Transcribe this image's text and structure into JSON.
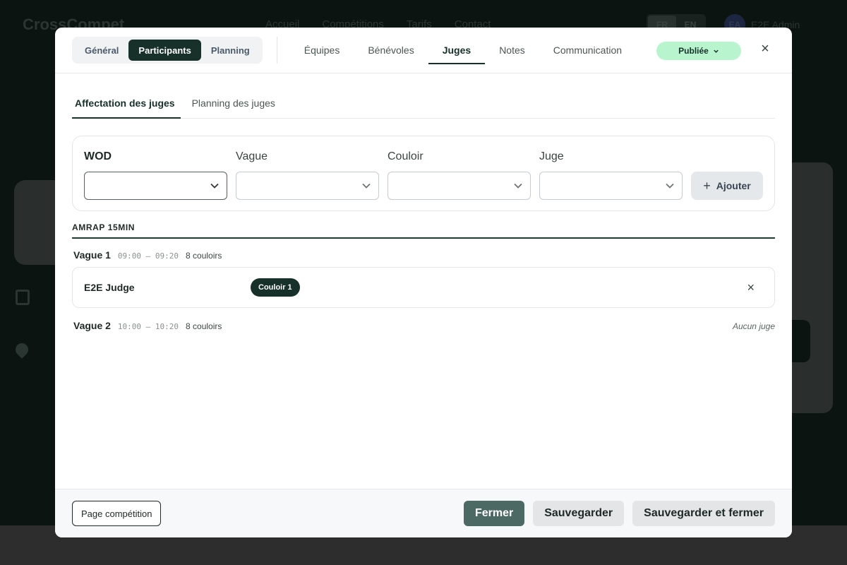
{
  "background": {
    "logo": "CrossCompet",
    "nav": [
      "Accueil",
      "Compétitions",
      "Tarifs",
      "Contact"
    ],
    "lang": [
      "FR",
      "EN"
    ],
    "user_initials": "EA",
    "user_name": "E2E Admin"
  },
  "header": {
    "segments": [
      "Général",
      "Participants",
      "Planning"
    ],
    "active_segment": "Participants",
    "tabs": [
      "Équipes",
      "Bénévoles",
      "Juges",
      "Notes",
      "Communication"
    ],
    "active_tab": "Juges",
    "status_label": "Publiée",
    "close_label": "×"
  },
  "subtabs": [
    "Affectation des juges",
    "Planning des juges"
  ],
  "filters": {
    "wod_label": "WOD",
    "wave_label": "Vague",
    "lane_label": "Couloir",
    "judge_label": "Juge",
    "add_label": "Ajouter"
  },
  "wod": {
    "title": "AMRAP 15MIN",
    "waves": [
      {
        "name": "Vague 1",
        "time": "09:00 – 09:20",
        "lanes": "8 couloirs",
        "judges": [
          {
            "name": "E2E Judge",
            "lane": "Couloir 1"
          }
        ]
      },
      {
        "name": "Vague 2",
        "time": "10:00 – 10:20",
        "lanes": "8 couloirs",
        "empty_label": "Aucun juge"
      }
    ]
  },
  "footer": {
    "page_label": "Page compétition",
    "close_label": "Fermer",
    "save_label": "Sauvegarder",
    "save_close_label": "Sauvegarder et fermer"
  },
  "colors": {
    "primary": "#17302a",
    "status_bg": "#b8f5cf",
    "close_button": "#4d6964"
  }
}
